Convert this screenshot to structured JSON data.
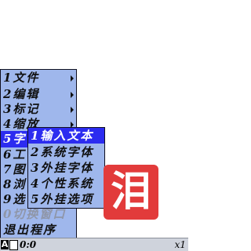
{
  "main_menu": {
    "items": [
      {
        "label": "1文件",
        "has_submenu": true,
        "disabled": false,
        "selected": false
      },
      {
        "label": "2编辑",
        "has_submenu": true,
        "disabled": false,
        "selected": false
      },
      {
        "label": "3标记",
        "has_submenu": true,
        "disabled": false,
        "selected": false
      },
      {
        "label": "4缩放",
        "has_submenu": true,
        "disabled": false,
        "selected": false
      },
      {
        "label": "5字",
        "has_submenu": true,
        "disabled": false,
        "selected": true
      },
      {
        "label": "6工",
        "has_submenu": false,
        "disabled": false,
        "selected": false
      },
      {
        "label": "7图",
        "has_submenu": false,
        "disabled": false,
        "selected": false
      },
      {
        "label": "8浏",
        "has_submenu": false,
        "disabled": false,
        "selected": false
      },
      {
        "label": "9选",
        "has_submenu": false,
        "disabled": false,
        "selected": false
      },
      {
        "label": "0切换窗口",
        "has_submenu": false,
        "disabled": true,
        "selected": false
      },
      {
        "label": "退出程序",
        "has_submenu": false,
        "disabled": false,
        "selected": false
      }
    ]
  },
  "submenu": {
    "items": [
      {
        "label": "1输入文本",
        "selected": true
      },
      {
        "label": "2系统字体",
        "selected": false
      },
      {
        "label": "3外挂字体",
        "selected": false
      },
      {
        "label": "4个性系统",
        "selected": false
      },
      {
        "label": "5外挂选项",
        "selected": false
      }
    ]
  },
  "app_icon": {
    "glyph": "泪",
    "color": "#e23b3b"
  },
  "status_bar": {
    "ime_mode": "A",
    "position": "0:0",
    "zoom": "x1"
  },
  "colors": {
    "menu_bg": "#9fb7ec",
    "selection": "#2c2cf0"
  }
}
